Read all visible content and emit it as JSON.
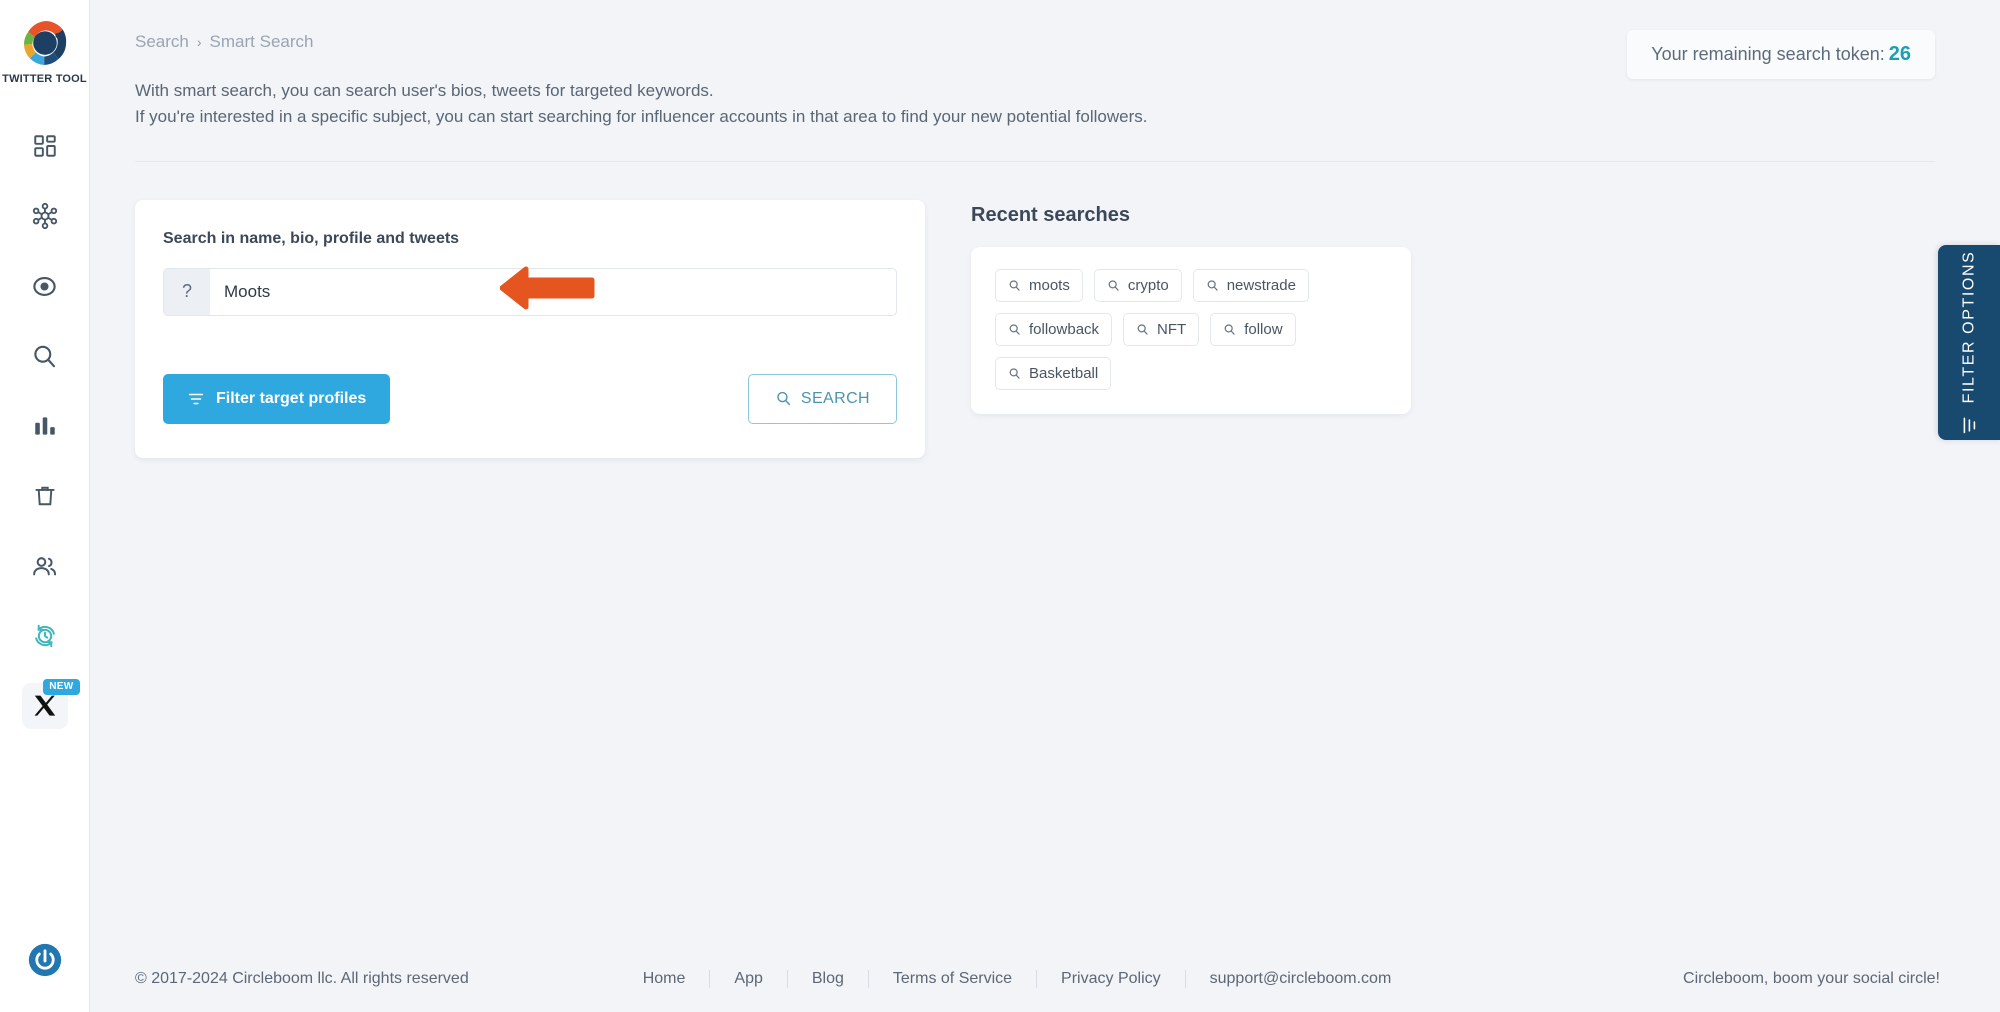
{
  "sidebar": {
    "logo_label": "TWITTER TOOL",
    "items": [
      {
        "name": "dashboard",
        "icon": "dashboard-grid-icon"
      },
      {
        "name": "network",
        "icon": "network-hub-icon"
      },
      {
        "name": "monitor",
        "icon": "eye-target-icon"
      },
      {
        "name": "search",
        "icon": "search-icon"
      },
      {
        "name": "analytics",
        "icon": "bar-chart-icon"
      },
      {
        "name": "delete",
        "icon": "trash-icon"
      },
      {
        "name": "users",
        "icon": "users-icon"
      },
      {
        "name": "scheduler",
        "icon": "refresh-clock-icon"
      },
      {
        "name": "x-platform",
        "icon": "x-logo-icon",
        "badge": "NEW"
      }
    ],
    "logout_icon": "power-logout-icon"
  },
  "header": {
    "token_label": "Your remaining search token:",
    "token_count": "26"
  },
  "breadcrumb": {
    "root": "Search",
    "separator": "›",
    "current": "Smart Search"
  },
  "description": {
    "line1": "With smart search, you can search user's bios, tweets for targeted keywords.",
    "line2": "If you're interested in a specific subject, you can start searching for influencer accounts in that area to find your new potential followers."
  },
  "search_card": {
    "label": "Search in name, bio, profile and tweets",
    "help_glyph": "?",
    "input_value": "Moots",
    "input_placeholder": "",
    "filter_button": "Filter target profiles",
    "search_button": "SEARCH"
  },
  "recent": {
    "title": "Recent searches",
    "tags": [
      "moots",
      "crypto",
      "newstrade",
      "followback",
      "NFT",
      "follow",
      "Basketball"
    ]
  },
  "filter_tab": {
    "label": "FILTER OPTIONS"
  },
  "annotation": {
    "arrow_color": "#e4551f",
    "direction": "left"
  },
  "footer": {
    "copyright": "© 2017-2024 Circleboom llc. All rights reserved",
    "links": [
      "Home",
      "App",
      "Blog",
      "Terms of Service",
      "Privacy Policy",
      "support@circleboom.com"
    ],
    "tagline": "Circleboom, boom your social circle!"
  },
  "colors": {
    "accent_blue": "#2fa8e0",
    "navy": "#18496f",
    "teal": "#1a9fb5",
    "arrow_orange": "#e4551f",
    "page_bg": "#f2f4f8"
  }
}
